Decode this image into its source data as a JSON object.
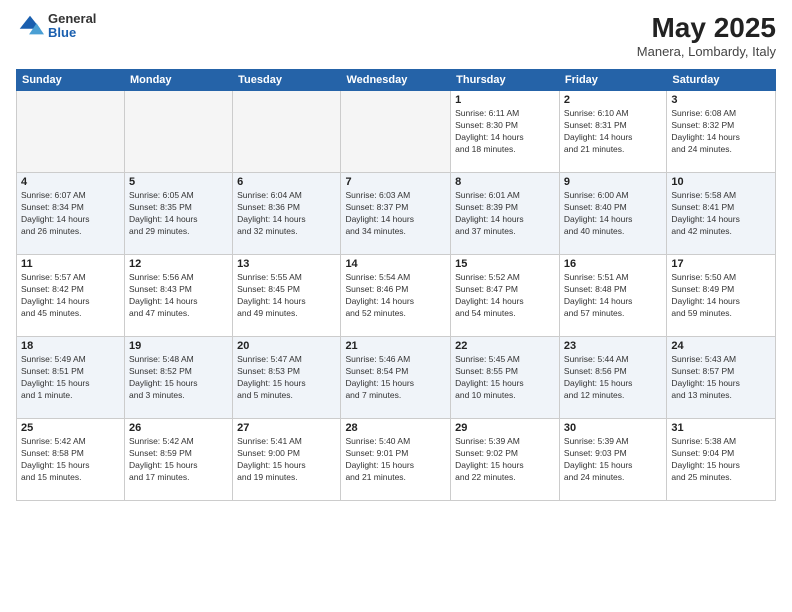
{
  "header": {
    "logo_general": "General",
    "logo_blue": "Blue",
    "month_title": "May 2025",
    "location": "Manera, Lombardy, Italy"
  },
  "days_of_week": [
    "Sunday",
    "Monday",
    "Tuesday",
    "Wednesday",
    "Thursday",
    "Friday",
    "Saturday"
  ],
  "weeks": [
    [
      {
        "day": "",
        "info": ""
      },
      {
        "day": "",
        "info": ""
      },
      {
        "day": "",
        "info": ""
      },
      {
        "day": "",
        "info": ""
      },
      {
        "day": "1",
        "info": "Sunrise: 6:11 AM\nSunset: 8:30 PM\nDaylight: 14 hours\nand 18 minutes."
      },
      {
        "day": "2",
        "info": "Sunrise: 6:10 AM\nSunset: 8:31 PM\nDaylight: 14 hours\nand 21 minutes."
      },
      {
        "day": "3",
        "info": "Sunrise: 6:08 AM\nSunset: 8:32 PM\nDaylight: 14 hours\nand 24 minutes."
      }
    ],
    [
      {
        "day": "4",
        "info": "Sunrise: 6:07 AM\nSunset: 8:34 PM\nDaylight: 14 hours\nand 26 minutes."
      },
      {
        "day": "5",
        "info": "Sunrise: 6:05 AM\nSunset: 8:35 PM\nDaylight: 14 hours\nand 29 minutes."
      },
      {
        "day": "6",
        "info": "Sunrise: 6:04 AM\nSunset: 8:36 PM\nDaylight: 14 hours\nand 32 minutes."
      },
      {
        "day": "7",
        "info": "Sunrise: 6:03 AM\nSunset: 8:37 PM\nDaylight: 14 hours\nand 34 minutes."
      },
      {
        "day": "8",
        "info": "Sunrise: 6:01 AM\nSunset: 8:39 PM\nDaylight: 14 hours\nand 37 minutes."
      },
      {
        "day": "9",
        "info": "Sunrise: 6:00 AM\nSunset: 8:40 PM\nDaylight: 14 hours\nand 40 minutes."
      },
      {
        "day": "10",
        "info": "Sunrise: 5:58 AM\nSunset: 8:41 PM\nDaylight: 14 hours\nand 42 minutes."
      }
    ],
    [
      {
        "day": "11",
        "info": "Sunrise: 5:57 AM\nSunset: 8:42 PM\nDaylight: 14 hours\nand 45 minutes."
      },
      {
        "day": "12",
        "info": "Sunrise: 5:56 AM\nSunset: 8:43 PM\nDaylight: 14 hours\nand 47 minutes."
      },
      {
        "day": "13",
        "info": "Sunrise: 5:55 AM\nSunset: 8:45 PM\nDaylight: 14 hours\nand 49 minutes."
      },
      {
        "day": "14",
        "info": "Sunrise: 5:54 AM\nSunset: 8:46 PM\nDaylight: 14 hours\nand 52 minutes."
      },
      {
        "day": "15",
        "info": "Sunrise: 5:52 AM\nSunset: 8:47 PM\nDaylight: 14 hours\nand 54 minutes."
      },
      {
        "day": "16",
        "info": "Sunrise: 5:51 AM\nSunset: 8:48 PM\nDaylight: 14 hours\nand 57 minutes."
      },
      {
        "day": "17",
        "info": "Sunrise: 5:50 AM\nSunset: 8:49 PM\nDaylight: 14 hours\nand 59 minutes."
      }
    ],
    [
      {
        "day": "18",
        "info": "Sunrise: 5:49 AM\nSunset: 8:51 PM\nDaylight: 15 hours\nand 1 minute."
      },
      {
        "day": "19",
        "info": "Sunrise: 5:48 AM\nSunset: 8:52 PM\nDaylight: 15 hours\nand 3 minutes."
      },
      {
        "day": "20",
        "info": "Sunrise: 5:47 AM\nSunset: 8:53 PM\nDaylight: 15 hours\nand 5 minutes."
      },
      {
        "day": "21",
        "info": "Sunrise: 5:46 AM\nSunset: 8:54 PM\nDaylight: 15 hours\nand 7 minutes."
      },
      {
        "day": "22",
        "info": "Sunrise: 5:45 AM\nSunset: 8:55 PM\nDaylight: 15 hours\nand 10 minutes."
      },
      {
        "day": "23",
        "info": "Sunrise: 5:44 AM\nSunset: 8:56 PM\nDaylight: 15 hours\nand 12 minutes."
      },
      {
        "day": "24",
        "info": "Sunrise: 5:43 AM\nSunset: 8:57 PM\nDaylight: 15 hours\nand 13 minutes."
      }
    ],
    [
      {
        "day": "25",
        "info": "Sunrise: 5:42 AM\nSunset: 8:58 PM\nDaylight: 15 hours\nand 15 minutes."
      },
      {
        "day": "26",
        "info": "Sunrise: 5:42 AM\nSunset: 8:59 PM\nDaylight: 15 hours\nand 17 minutes."
      },
      {
        "day": "27",
        "info": "Sunrise: 5:41 AM\nSunset: 9:00 PM\nDaylight: 15 hours\nand 19 minutes."
      },
      {
        "day": "28",
        "info": "Sunrise: 5:40 AM\nSunset: 9:01 PM\nDaylight: 15 hours\nand 21 minutes."
      },
      {
        "day": "29",
        "info": "Sunrise: 5:39 AM\nSunset: 9:02 PM\nDaylight: 15 hours\nand 22 minutes."
      },
      {
        "day": "30",
        "info": "Sunrise: 5:39 AM\nSunset: 9:03 PM\nDaylight: 15 hours\nand 24 minutes."
      },
      {
        "day": "31",
        "info": "Sunrise: 5:38 AM\nSunset: 9:04 PM\nDaylight: 15 hours\nand 25 minutes."
      }
    ]
  ]
}
